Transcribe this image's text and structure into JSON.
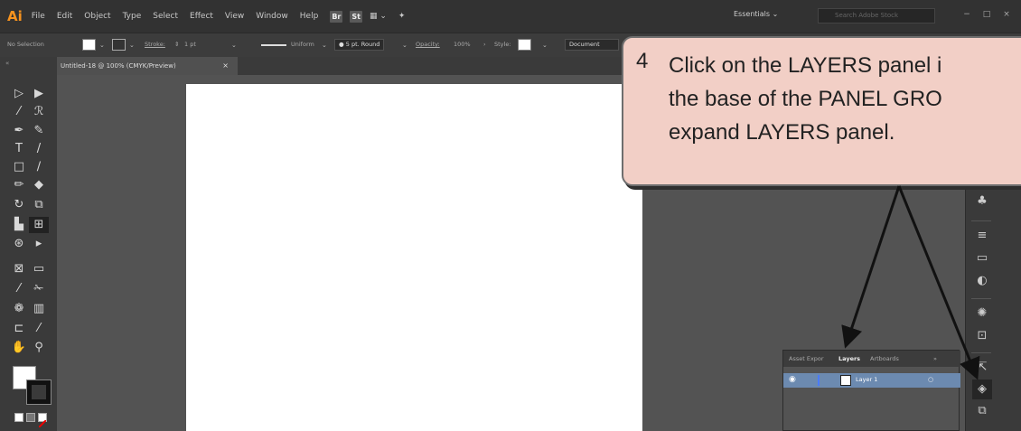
{
  "app": {
    "logo": "Ai"
  },
  "menu": [
    "File",
    "Edit",
    "Object",
    "Type",
    "Select",
    "Effect",
    "View",
    "Window",
    "Help"
  ],
  "menubar_icons": [
    "Br",
    "St"
  ],
  "workspace": "Essentials ⌄",
  "stock_search_placeholder": "Search Adobe Stock",
  "window_buttons": {
    "minimize": "−",
    "maximize": "□",
    "close": "×"
  },
  "controlbar": {
    "selection": "No Selection",
    "stroke_label": "Stroke:",
    "stroke_value": "1 pt",
    "profile": "Uniform",
    "brush": "5 pt. Round",
    "opacity_label": "Opacity:",
    "opacity_value": "100%",
    "style_label": "Style:",
    "document_button": "Document"
  },
  "document_tab": {
    "title": "Untitled-18 @ 100% (CMYK/Preview)",
    "close": "×"
  },
  "toolbar_grip": "«",
  "layers_panel": {
    "tabs": [
      "Asset Expor",
      "Layers",
      "Artboards"
    ],
    "more": "»",
    "layer_name": "Layer 1",
    "target_glyph": "○"
  },
  "callout": {
    "number": "4",
    "text": "Click on the LAYERS panel i\nthe base of the PANEL GRO\nexpand LAYERS panel."
  },
  "colors": {
    "accent": "#f7931e",
    "callout_bg": "#f2cfc6",
    "layer_row": "#6c8ab0"
  }
}
